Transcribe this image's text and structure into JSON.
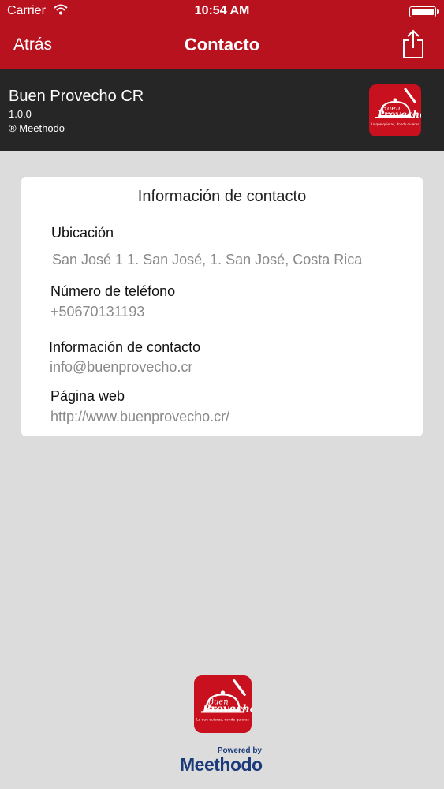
{
  "status_bar": {
    "carrier": "Carrier",
    "time": "10:54 AM"
  },
  "nav": {
    "back_label": "Atrás",
    "title": "Contacto"
  },
  "app_header": {
    "name": "Buen Provecho CR",
    "version": "1.0.0",
    "copyright": "® Meethodo"
  },
  "logo": {
    "line1": "Buen",
    "line2": "Provecho",
    "suffix": "cr",
    "tagline": "Lo que quieras, donde quieras"
  },
  "contact_card": {
    "title": "Información de contacto",
    "location_label": "Ubicación",
    "location_value": "San José 1 1. San José, 1. San José, Costa Rica",
    "phone_label": "Número de teléfono",
    "phone_value": "+50670131193",
    "contact_label": "Información de contacto",
    "contact_value": "info@buenprovecho.cr",
    "web_label": "Página web",
    "web_value": "http://www.buenprovecho.cr/"
  },
  "footer": {
    "powered_by": "Powered by",
    "brand": "Meethodo"
  },
  "colors": {
    "brand_red": "#b8121f",
    "header_dark": "#262626",
    "background": "#dcdcdc",
    "meethodo_blue": "#1b3a7a"
  }
}
